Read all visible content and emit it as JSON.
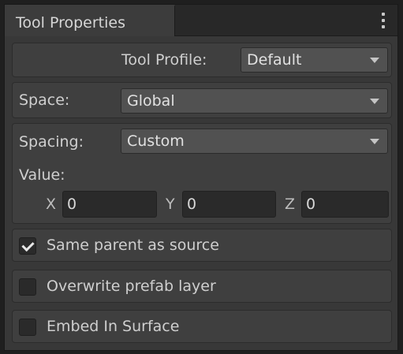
{
  "window": {
    "tab_title": "Tool Properties",
    "menu_icon": "vertical-ellipsis-icon"
  },
  "tool_profile": {
    "label": "Tool Profile:",
    "value": "Default"
  },
  "space": {
    "label": "Space:",
    "value": "Global"
  },
  "spacing": {
    "label": "Spacing:",
    "value": "Custom",
    "value_label": "Value:",
    "x_label": "X",
    "x_value": "0",
    "y_label": "Y",
    "y_value": "0",
    "z_label": "Z",
    "z_value": "0"
  },
  "toggles": [
    {
      "label": "Same parent as source",
      "checked": true
    },
    {
      "label": "Overwrite prefab layer",
      "checked": false
    },
    {
      "label": "Embed In Surface",
      "checked": false
    }
  ],
  "colors": {
    "panel_bg": "#383838",
    "group_bg": "#3f3f3f",
    "dropdown_bg": "#515151",
    "field_bg": "#2a2a2a",
    "text": "#d2d2d2"
  }
}
